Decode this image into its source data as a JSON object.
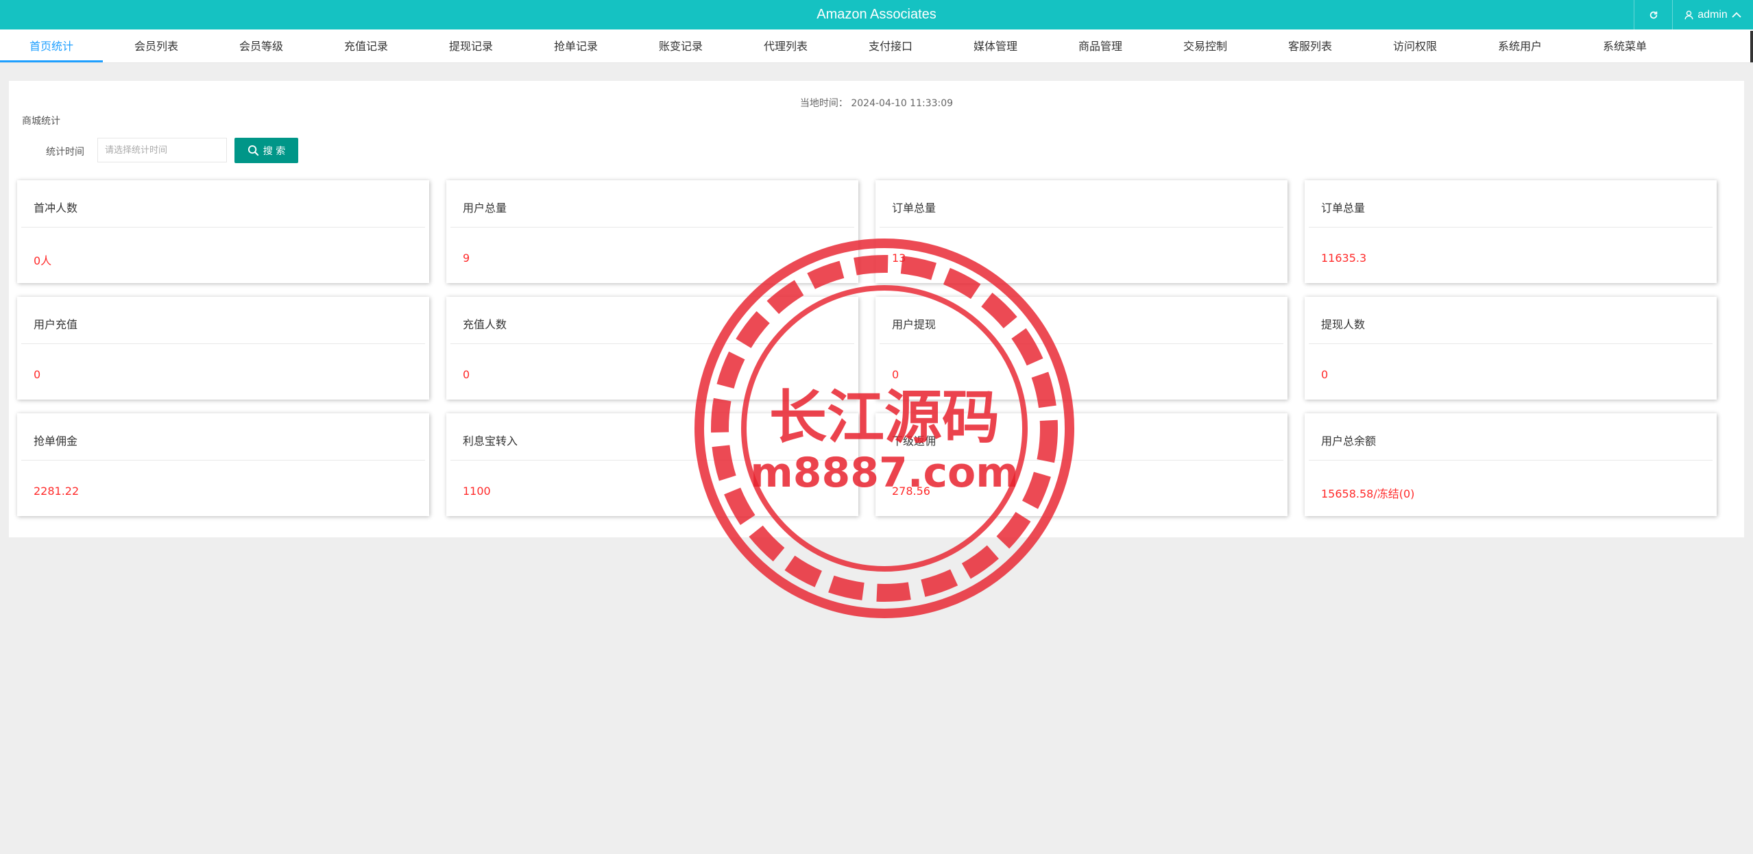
{
  "header": {
    "title": "Amazon Associates",
    "user": "admin"
  },
  "nav": {
    "tabs": [
      {
        "label": "首页统计",
        "active": true
      },
      {
        "label": "会员列表"
      },
      {
        "label": "会员等级"
      },
      {
        "label": "充值记录"
      },
      {
        "label": "提现记录"
      },
      {
        "label": "抢单记录"
      },
      {
        "label": "账变记录"
      },
      {
        "label": "代理列表"
      },
      {
        "label": "支付接口"
      },
      {
        "label": "媒体管理"
      },
      {
        "label": "商品管理"
      },
      {
        "label": "交易控制"
      },
      {
        "label": "客服列表"
      },
      {
        "label": "访问权限"
      },
      {
        "label": "系统用户"
      },
      {
        "label": "系统菜单"
      }
    ]
  },
  "main": {
    "local_time": "当地时间： 2024-04-10 11:33:09",
    "section_title": "商城统计",
    "filter": {
      "label": "统计时间",
      "placeholder": "请选择统计时间",
      "search_label": "搜 索"
    },
    "cards": [
      {
        "title": "首冲人数",
        "value": "0人"
      },
      {
        "title": "用户总量",
        "value": "9"
      },
      {
        "title": "订单总量",
        "value": "13"
      },
      {
        "title": "订单总量",
        "value": "11635.3"
      },
      {
        "title": "用户充值",
        "value": "0"
      },
      {
        "title": "充值人数",
        "value": "0"
      },
      {
        "title": "用户提现",
        "value": "0"
      },
      {
        "title": "提现人数",
        "value": "0"
      },
      {
        "title": "抢单佣金",
        "value": "2281.22"
      },
      {
        "title": "利息宝转入",
        "value": "1100"
      },
      {
        "title": "下级返佣",
        "value": "278.56"
      },
      {
        "title": "用户总余额",
        "value": "15658.58/冻结(0)"
      }
    ]
  },
  "watermark": {
    "name": "长江源码",
    "url": "m8887.com",
    "color": "#e8222e"
  },
  "colors": {
    "header": "#15c2c2",
    "active_tab": "#1e9fff",
    "button": "#009688",
    "value": "#ff2a2a"
  }
}
